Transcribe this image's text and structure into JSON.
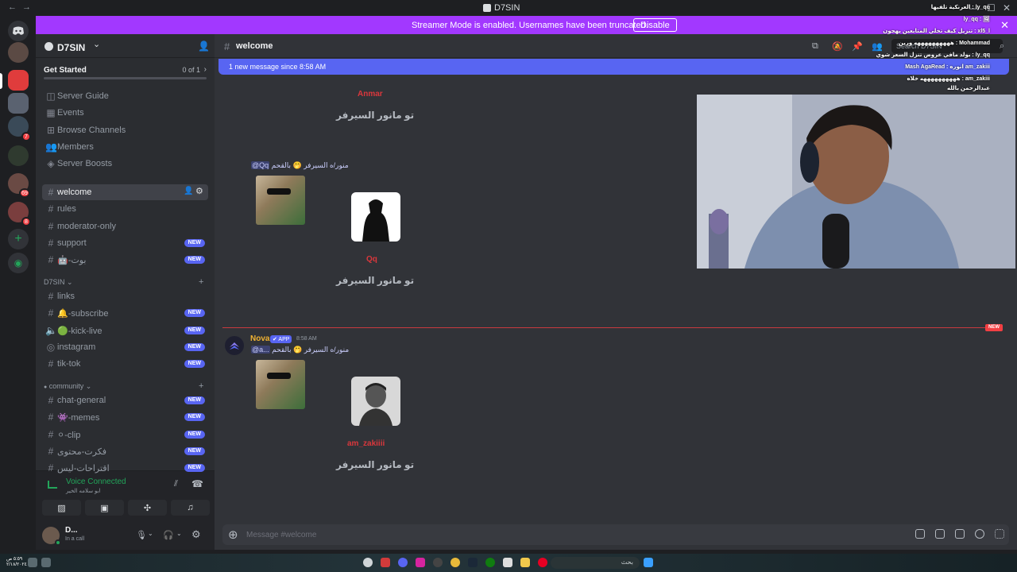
{
  "window": {
    "title": "D7SIN",
    "back": "←",
    "forward": "→",
    "minimize": "—",
    "maximize": "☐",
    "close": "✕"
  },
  "banner": {
    "text": "Streamer Mode is enabled. Usernames have been truncated.",
    "button": "Disable",
    "close": "✕"
  },
  "rail": {
    "badges": [
      "7",
      "69",
      "8"
    ]
  },
  "server": {
    "name": "D7SIN",
    "chevron": "⌄",
    "get_started": "Get Started",
    "progress_text": "0 of 1",
    "progress": 0.0,
    "top_items": [
      {
        "icon": "◫",
        "label": "Server Guide"
      },
      {
        "icon": "▦",
        "label": "Events"
      },
      {
        "icon": "⊞",
        "label": "Browse Channels"
      },
      {
        "icon": "👥",
        "label": "Members"
      },
      {
        "icon": "◈",
        "label": "Server Boosts"
      }
    ],
    "channels": [
      {
        "label": "welcome",
        "active": true,
        "new": ""
      },
      {
        "label": "rules",
        "active": false,
        "new": ""
      },
      {
        "label": "moderator-only",
        "active": false,
        "new": ""
      },
      {
        "label": "support",
        "active": false,
        "new": "NEW"
      },
      {
        "label": "🤖-بوت",
        "active": false,
        "new": "NEW"
      }
    ],
    "cat1": {
      "name": "D7SIN",
      "chev": "⌄",
      "plus": "+"
    },
    "cat1_channels": [
      {
        "label": "links",
        "new": ""
      },
      {
        "label": "🔔-subscribe",
        "new": "NEW"
      },
      {
        "label": "🟢-kick-live",
        "new": "NEW"
      },
      {
        "label": "instagram",
        "new": "NEW"
      },
      {
        "label": "tik-tok",
        "new": "NEW"
      }
    ],
    "cat2": {
      "name": "community",
      "chev": "⌄",
      "plus": "+"
    },
    "cat2_channels": [
      {
        "label": "chat-general",
        "new": "NEW"
      },
      {
        "label": "👾-memes",
        "new": "NEW"
      },
      {
        "label": "⚪-clip",
        "new": "NEW"
      },
      {
        "label": "فكرت-محتوى",
        "new": "NEW"
      },
      {
        "label": "اقتراحات-ليس",
        "new": "NEW"
      }
    ]
  },
  "voice": {
    "status": "Voice Connected",
    "sub": "ابو سلامه الخير"
  },
  "user": {
    "name": "D...",
    "status": "In a call"
  },
  "chat": {
    "channel": "welcome",
    "search_placeholder": "Search D7SIN",
    "new_messages": "1 new message since 8:58 AM",
    "welcome1": {
      "name": "Anmar",
      "text": "تو مانور السيرفر"
    },
    "msg2": {
      "mention": "@Qq",
      "text": "منور/ه السيرفر 🤭 بالقحم"
    },
    "welcome2": {
      "name": "Qq",
      "text": "تو مانور السيرفر"
    },
    "new_tag": "NEW",
    "msg3": {
      "author": "Nova",
      "app": "✔ APP",
      "time": "8:58 AM",
      "mention": "@a...",
      "text": "منور/ه السيرفر 🤭 بالقحم"
    },
    "welcome3": {
      "name": "am_zakiiii",
      "text": "تو مانور السيرفر"
    },
    "composer_placeholder": "Message #welcome"
  },
  "overlay": [
    {
      "text": "العرنكية تلفيها : ly_qq"
    },
    {
      "text": "ly_qq : 🖼"
    },
    {
      "text": "ههههههههههه ورين : Mohammad"
    },
    {
      "text": "تنزيل كيف تخلي المتابعين يهجون : xl5_l"
    },
    {
      "text": "بولد مافي عروض تنزل السعر شوي : ly_qq"
    },
    {
      "text": "Mash AgaRead : انوره am_zakiii"
    },
    {
      "text": "ههههههههههه خلاه : am_zakiii"
    },
    {
      "text": "عبدالرحمن بالله"
    }
  ],
  "taskbar": {
    "search": "بحث",
    "time": "٥:٥٩ ص",
    "date": "٢/١٨/٢٠٢٤"
  }
}
